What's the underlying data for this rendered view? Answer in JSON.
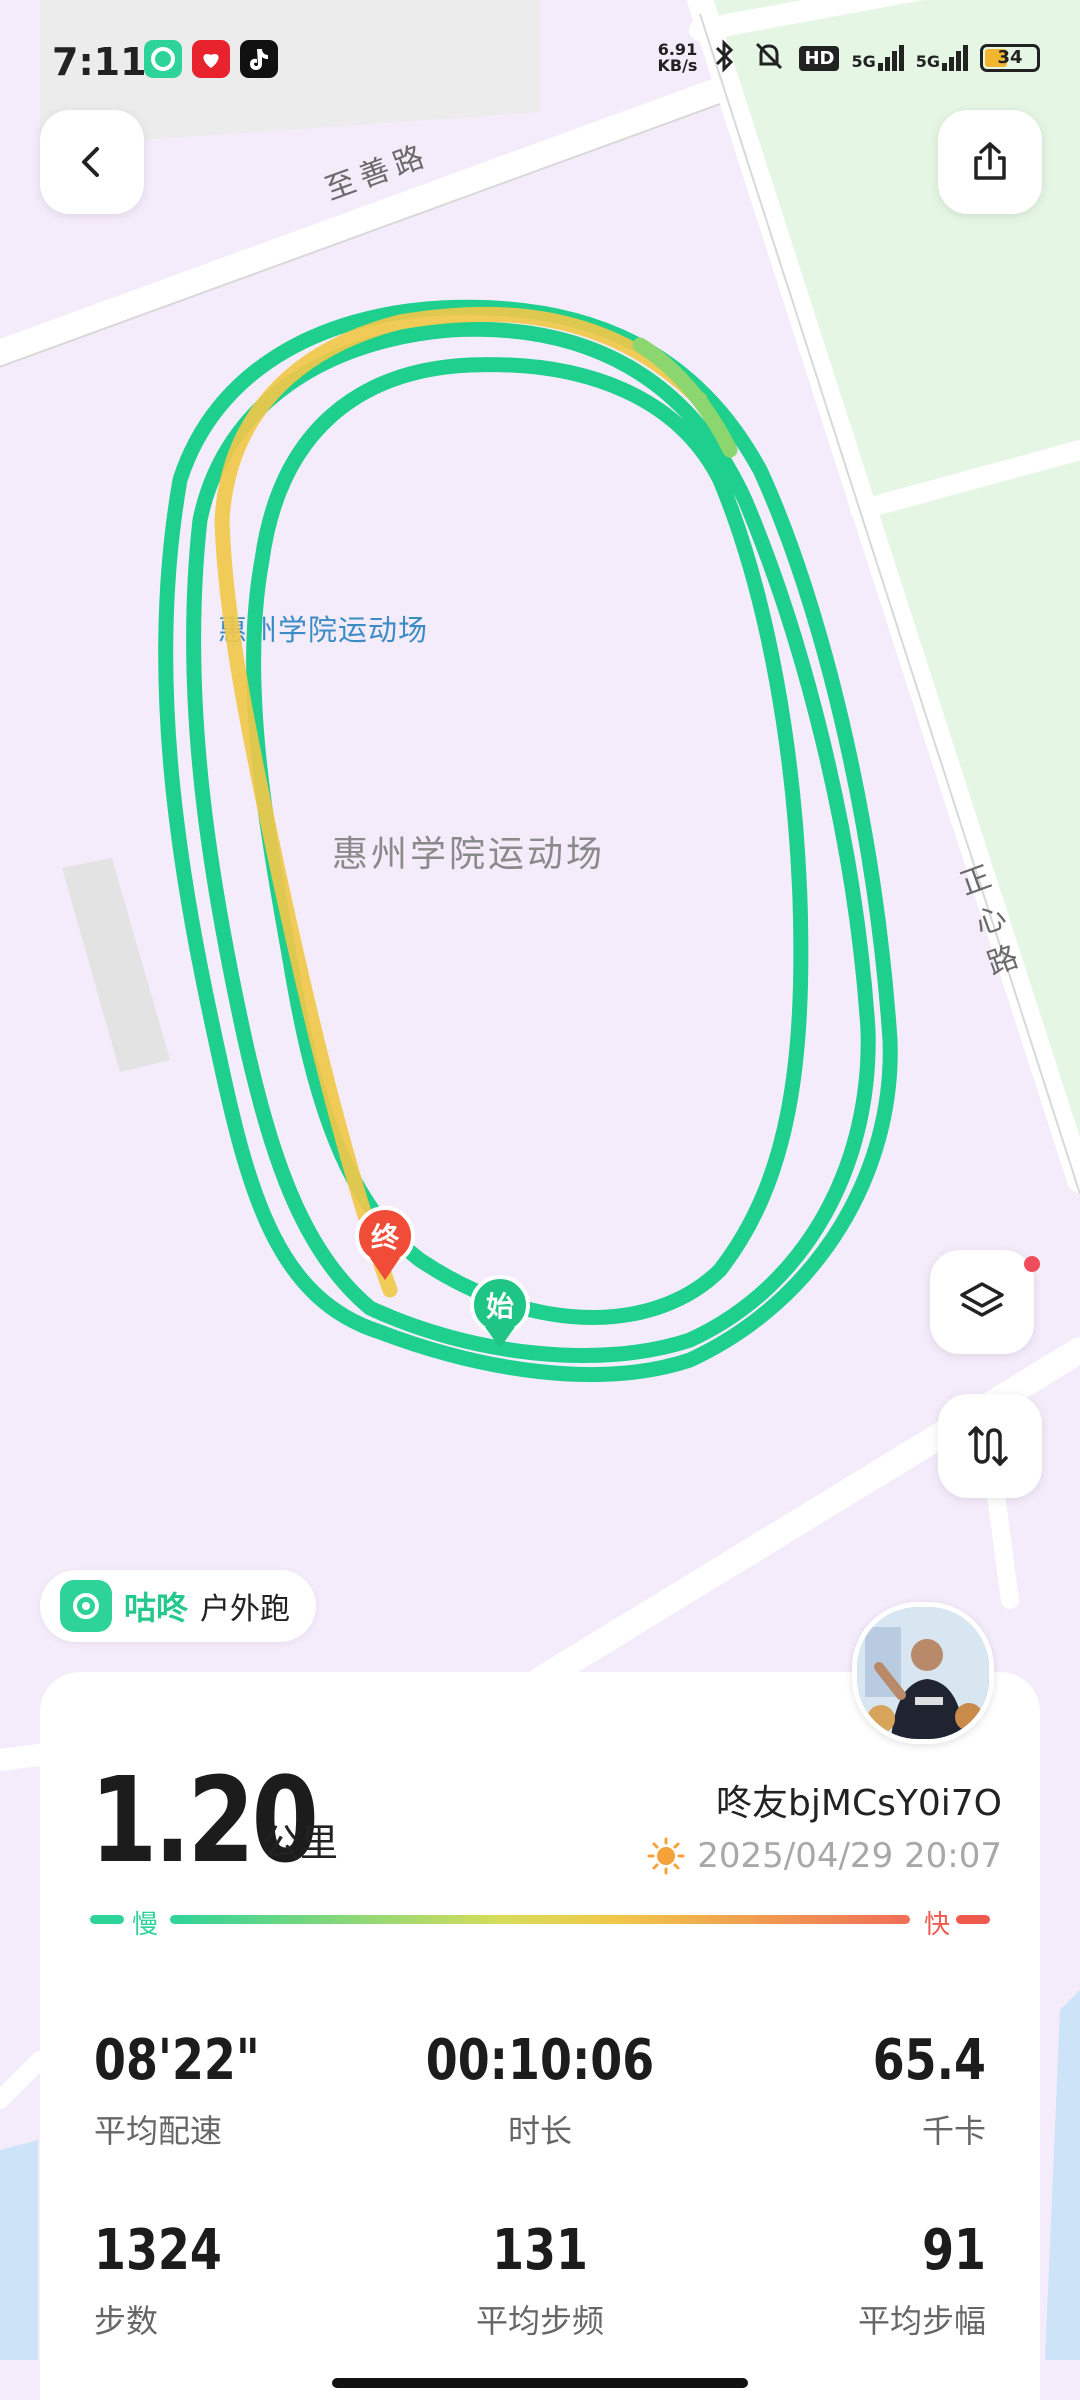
{
  "status_bar": {
    "time": "7:11",
    "net_speed_value": "6.91",
    "net_speed_unit": "KB/s",
    "hd_label": "HD",
    "sim1_label": "5G",
    "sim2_label": "5G",
    "battery_level": "34",
    "app_icons": [
      "coolapp-icon",
      "xiaohongshu-icon",
      "tiktok-icon"
    ]
  },
  "map": {
    "roads": [
      "至善路",
      "正",
      "心",
      "路"
    ],
    "venue_label_blue": "惠州学院运动场",
    "venue_label_gray": "惠州学院运动场",
    "start_marker": "始",
    "end_marker": "终",
    "route_color": "#1fcf8e",
    "last_segment_color": "#f0c84a"
  },
  "badge": {
    "brand": "咕咚",
    "sport": "户外跑"
  },
  "summary": {
    "distance": "1.20",
    "distance_unit": "公里",
    "username": "咚友bjMCsY0i7O",
    "datetime": "2025/04/29 20:07",
    "pace_slow": "慢",
    "pace_fast": "快"
  },
  "stats": [
    {
      "value": "08'22\"",
      "label": "平均配速"
    },
    {
      "value": "00:10:06",
      "label": "时长"
    },
    {
      "value": "65.4",
      "label": "千卡"
    },
    {
      "value": "1324",
      "label": "步数"
    },
    {
      "value": "131",
      "label": "平均步频"
    },
    {
      "value": "91",
      "label": "平均步幅"
    }
  ],
  "colors": {
    "accent": "#2ed39a",
    "fast": "#f05a4e",
    "map_bg": "#f5ecfb",
    "park": "#e6f6e4"
  }
}
